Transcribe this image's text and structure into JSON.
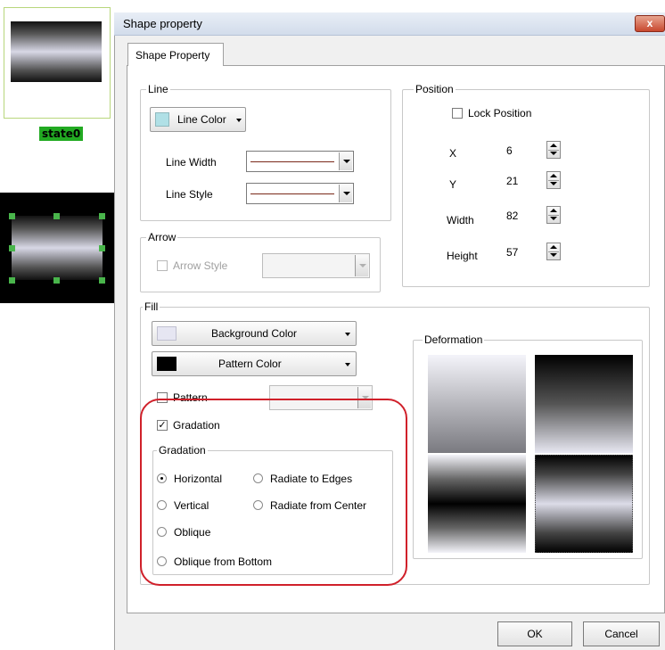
{
  "left_panel": {
    "state_label": "state0"
  },
  "dialog": {
    "title": "Shape property",
    "close_glyph": "x",
    "tab_label": "Shape Property",
    "line_group": {
      "title": "Line",
      "color_button": "Line Color",
      "color_swatch": "#b0e0e6",
      "width_label": "Line Width",
      "style_label": "Line Style",
      "line_color": "#7a2a1a"
    },
    "arrow_group": {
      "title": "Arrow",
      "arrow_style_label": "Arrow Style",
      "arrow_style_checked": false
    },
    "position_group": {
      "title": "Position",
      "lock_label": "Lock Position",
      "lock_checked": false,
      "fields": [
        {
          "label": "X",
          "value": "6"
        },
        {
          "label": "Y",
          "value": "21"
        },
        {
          "label": "Width",
          "value": "82"
        },
        {
          "label": "Height",
          "value": "57"
        }
      ]
    },
    "fill_group": {
      "title": "Fill",
      "background_color_label": "Background Color",
      "background_swatch": "#e6e6f2",
      "pattern_color_label": "Pattern Color",
      "pattern_swatch": "#000000",
      "pattern_label": "Pattern",
      "pattern_checked": false,
      "gradation_label": "Gradation",
      "gradation_checked": true,
      "gradation_subgroup_title": "Gradation",
      "options": {
        "horizontal": "Horizontal",
        "radiate_edges": "Radiate to Edges",
        "vertical": "Vertical",
        "radiate_center": "Radiate from Center",
        "oblique": "Oblique",
        "oblique_bottom": "Oblique from Bottom"
      },
      "selected_option": "Horizontal"
    },
    "deformation_group": {
      "title": "Deformation"
    },
    "buttons": {
      "ok": "OK",
      "cancel": "Cancel"
    },
    "highlight_color": "#d0202a"
  }
}
